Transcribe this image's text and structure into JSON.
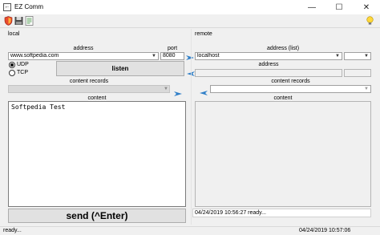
{
  "window": {
    "title": "EZ Comm",
    "app_icon_glyph": "←",
    "min_glyph": "—",
    "max_glyph": "☐",
    "close_glyph": "✕"
  },
  "toolbar": {
    "icons": [
      "shield-icon",
      "save-icon",
      "document-icon",
      "lightbulb-icon"
    ]
  },
  "local": {
    "section_label": "local",
    "address_label": "address",
    "port_label": "port",
    "address_value": "www.softpedia.com",
    "port_value": "8080",
    "listen_label": "listen",
    "udp_label": "UDP",
    "tcp_label": "TCP",
    "protocol_selected": "UDP",
    "content_records_label": "content records",
    "content_label": "content",
    "content_text": "Softpedia Test",
    "send_label": "send (^Enter)"
  },
  "remote": {
    "section_label": "remote",
    "address_list_label": "address (list)",
    "address_list_value": "localhost",
    "address_label": "address",
    "content_records_label": "content records",
    "content_label": "content",
    "log_text": "04/24/2019 10:56:27 ready..."
  },
  "status": {
    "left_text": "ready...",
    "right_text": "04/24/2019 10:57:06"
  },
  "colors": {
    "window_bg": "#f0f0f0",
    "arrow_blue": "#2f7fc8",
    "field_border": "#a0a0a0"
  }
}
